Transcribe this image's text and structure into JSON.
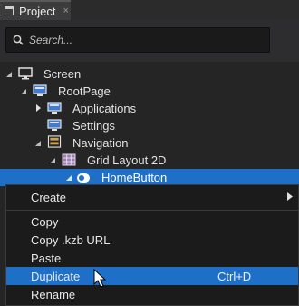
{
  "tab": {
    "title": "Project",
    "close": "×"
  },
  "search": {
    "placeholder": "Search..."
  },
  "tree": [
    {
      "label": "Screen",
      "icon": "screen-icon"
    },
    {
      "label": "RootPage",
      "icon": "page-icon"
    },
    {
      "label": "Applications",
      "icon": "page-icon"
    },
    {
      "label": "Settings",
      "icon": "page-icon"
    },
    {
      "label": "Navigation",
      "icon": "navigation-icon"
    },
    {
      "label": "Grid Layout 2D",
      "icon": "grid-layout-icon"
    },
    {
      "label": "HomeButton",
      "icon": "toggle-button-icon"
    }
  ],
  "menu": {
    "items": [
      {
        "label": "Create",
        "shortcut": ""
      },
      {
        "label": "Copy",
        "shortcut": ""
      },
      {
        "label": "Copy .kzb URL",
        "shortcut": ""
      },
      {
        "label": "Paste",
        "shortcut": ""
      },
      {
        "label": "Duplicate",
        "shortcut": "Ctrl+D"
      },
      {
        "label": "Rename",
        "shortcut": ""
      }
    ],
    "highlighted": "Duplicate"
  },
  "colors": {
    "selection": "#1e6fc8",
    "background": "#252526",
    "menu": "#1b1b1b"
  }
}
